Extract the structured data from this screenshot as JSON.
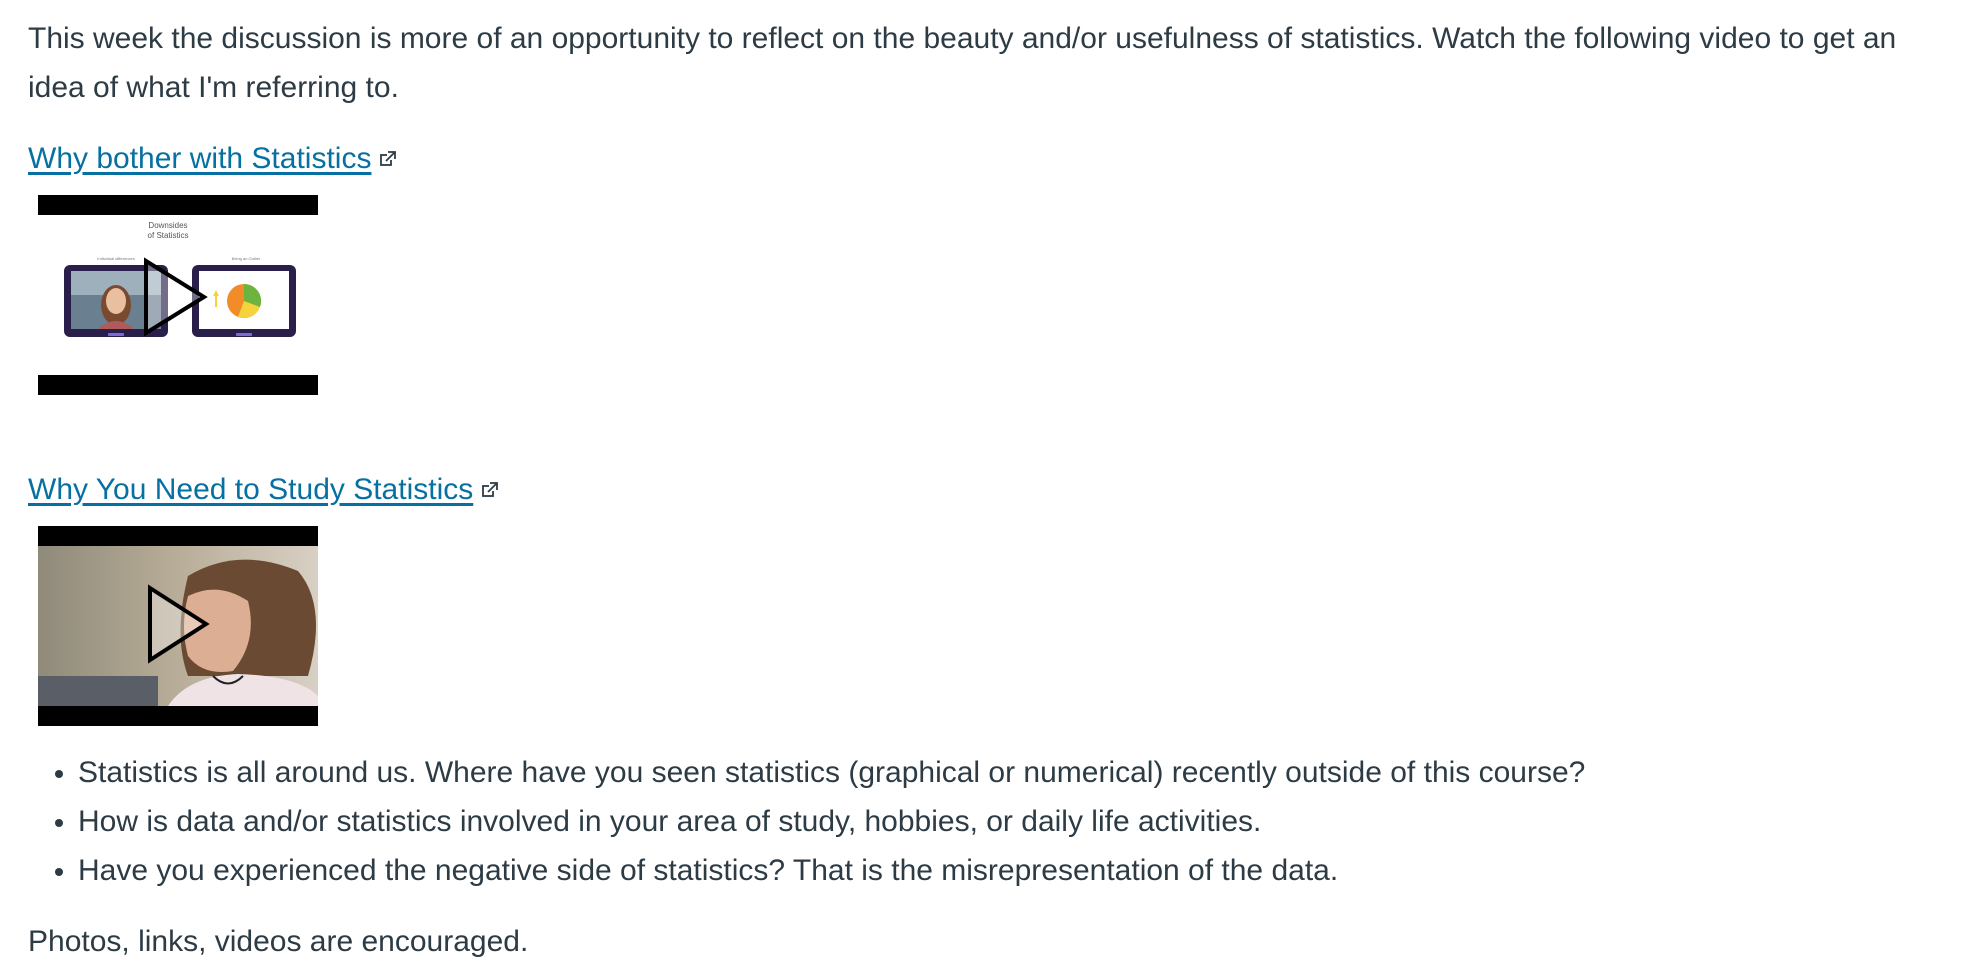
{
  "intro": "This week the discussion is more of an opportunity to reflect on the beauty and/or usefulness of statistics.  Watch the following video to get an idea of what I'm referring to.",
  "videos": [
    {
      "link_text": "Why bother with Statistics",
      "thumbnail": {
        "title_line1": "Downsides",
        "title_line2": "of Statistics",
        "label_left": "Individual differences",
        "label_right": "Being an Outlier"
      }
    },
    {
      "link_text": "Why You Need to Study Statistics"
    }
  ],
  "questions": [
    "Statistics is all around us.  Where have you seen statistics (graphical or numerical) recently outside of this course?",
    "How is data and/or statistics involved in your area of study, hobbies, or daily life activities.",
    "Have you experienced the negative side of statistics?  That is the misrepresentation of the data."
  ],
  "closing": "Photos, links, videos are encouraged.",
  "colors": {
    "text": "#2d3b45",
    "link": "#0770a3",
    "tablet_frame": "#2a1f4a",
    "pie_orange": "#f28c28",
    "pie_green": "#6db33f",
    "pie_yellow": "#f5d33c"
  },
  "icons": {
    "external_link": "external-link-icon",
    "play": "play-icon"
  }
}
